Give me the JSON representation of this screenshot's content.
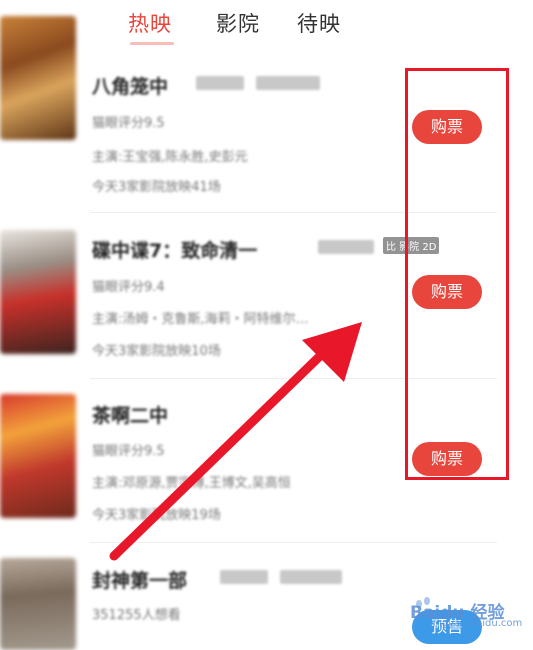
{
  "tabs": [
    {
      "label": "热映",
      "active": true
    },
    {
      "label": "影院",
      "active": false
    },
    {
      "label": "待映",
      "active": false
    }
  ],
  "movies": [
    {
      "title": "八角笼中",
      "rating": "猫眼评分9.5",
      "cast": "主演:王宝强,陈永胜,史彭元",
      "shows": "今天3家影院放映41场",
      "button": "购票"
    },
    {
      "title": "碟中谍7：致命清一",
      "rating": "猫眼评分9.4",
      "cast": "主演:汤姆・克鲁斯,海莉・阿特维尔…",
      "shows": "今天3家影院放映10场",
      "button": "购票",
      "tag": "比 影院 2D"
    },
    {
      "title": "茶啊二中",
      "rating": "猫眼评分9.5",
      "cast": "主演:邓原源,贾宇博,王博文,吴高恒",
      "shows": "今天3家影院放映19场",
      "button": "购票"
    },
    {
      "title": "封神第一部",
      "rating": "351255人想看",
      "button": "预售"
    }
  ],
  "watermark": {
    "brand": "Baidu 经验",
    "url": "jingyan.baidu.com"
  },
  "colors": {
    "accent": "#e8453c",
    "presale": "#3c9ae8",
    "highlight": "#e8172a"
  }
}
